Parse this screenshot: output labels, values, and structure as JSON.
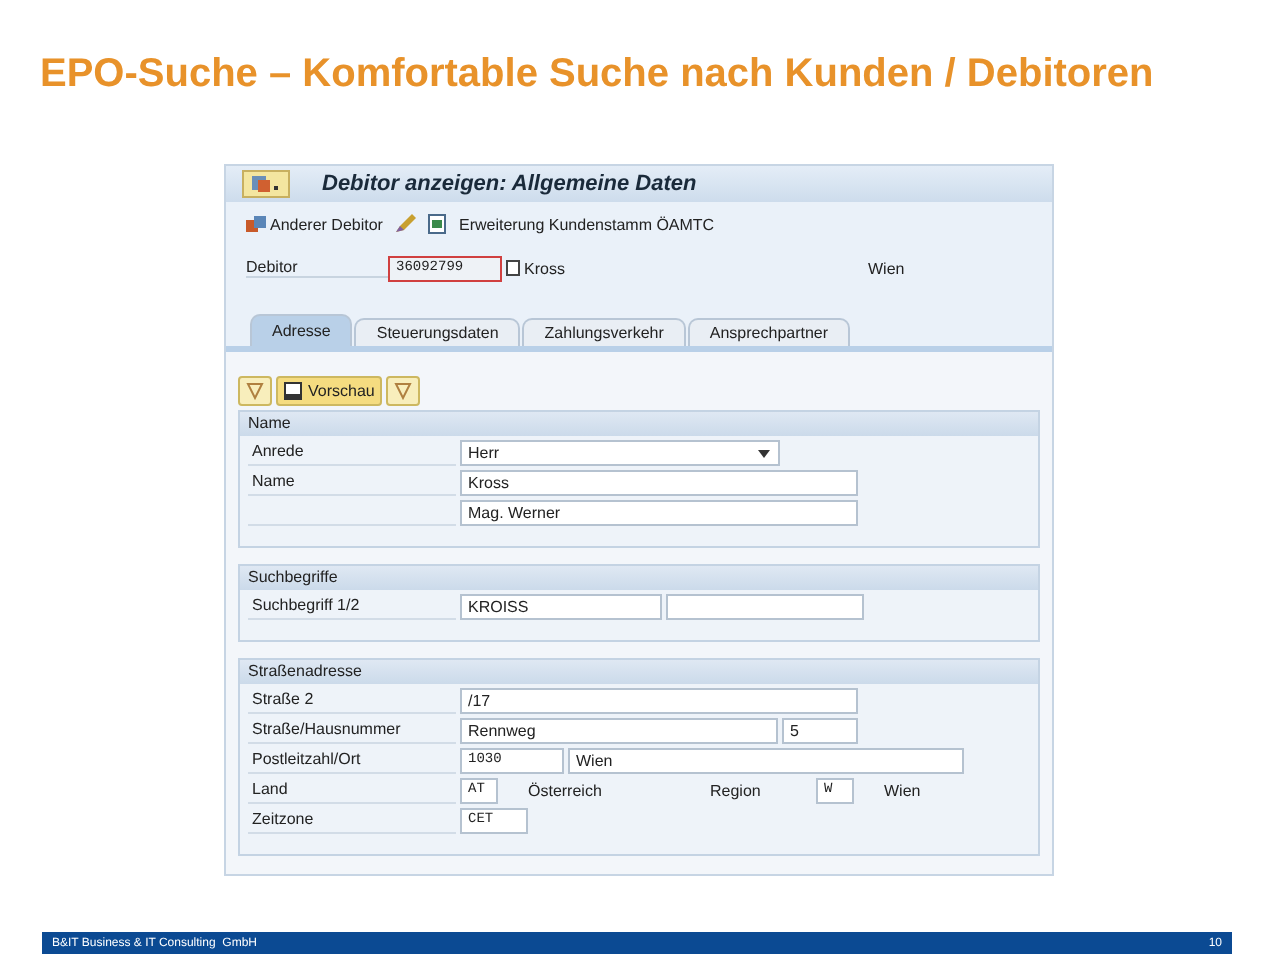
{
  "slide_title": "EPO-Suche – Komfortable Suche nach Kunden / Debitoren",
  "window": {
    "title": "Debitor anzeigen: Allgemeine Daten",
    "toolbar": [
      {
        "kind": "other-debtor",
        "label": "Anderer Debitor"
      },
      {
        "kind": "edit"
      },
      {
        "kind": "document"
      },
      {
        "kind": "text",
        "label": "Erweiterung Kundenstamm ÖAMTC"
      }
    ],
    "debitor": {
      "label": "Debitor",
      "value": "36092799",
      "name": "Kross",
      "city": "Wien"
    },
    "tabs": [
      {
        "label": "Adresse",
        "selected": true
      },
      {
        "label": "Steuerungsdaten",
        "selected": false
      },
      {
        "label": "Zahlungsverkehr",
        "selected": false
      },
      {
        "label": "Ansprechpartner",
        "selected": false
      }
    ],
    "actions": [
      {
        "kind": "icon"
      },
      {
        "kind": "preview",
        "label": "Vorschau"
      },
      {
        "kind": "icon"
      }
    ],
    "groups": [
      {
        "title": "Name",
        "rows": [
          {
            "label": "Anrede",
            "items": [
              {
                "kind": "dropdown",
                "value": "Herr"
              }
            ]
          },
          {
            "label": "Name",
            "items": [
              {
                "kind": "field",
                "value": "Kross"
              }
            ]
          },
          {
            "items": [
              {
                "kind": "field",
                "value": "Mag. Werner"
              }
            ]
          }
        ]
      },
      {
        "title": "Suchbegriffe",
        "rows": [
          {
            "label": "Suchbegriff 1/2",
            "items": [
              {
                "kind": "field",
                "value": "KROISS"
              },
              {
                "kind": "field"
              }
            ]
          }
        ]
      },
      {
        "title": "Straßenadresse",
        "rows": [
          {
            "label": "Straße 2",
            "items": [
              {
                "kind": "field",
                "value": "/17"
              }
            ]
          },
          {
            "label": "Straße/Hausnummer",
            "items": [
              {
                "kind": "field",
                "value": "Rennweg"
              },
              {
                "kind": "field",
                "value": "5"
              }
            ]
          },
          {
            "label": "Postleitzahl/Ort",
            "items": [
              {
                "kind": "code",
                "value": "1030"
              },
              {
                "kind": "field",
                "value": "Wien"
              }
            ]
          },
          {
            "label": "Land",
            "items": [
              {
                "kind": "code",
                "value": "AT"
              },
              {
                "kind": "text",
                "value": "Österreich"
              },
              {
                "kind": "text",
                "value": "Region"
              },
              {
                "kind": "code",
                "value": "W"
              },
              {
                "kind": "text",
                "value": "Wien"
              }
            ]
          },
          {
            "label": "Zeitzone",
            "items": [
              {
                "kind": "code",
                "value": "CET"
              }
            ]
          }
        ]
      }
    ]
  },
  "footer": {
    "company": "B&IT Business & IT Consulting  GmbH",
    "page": "10"
  }
}
